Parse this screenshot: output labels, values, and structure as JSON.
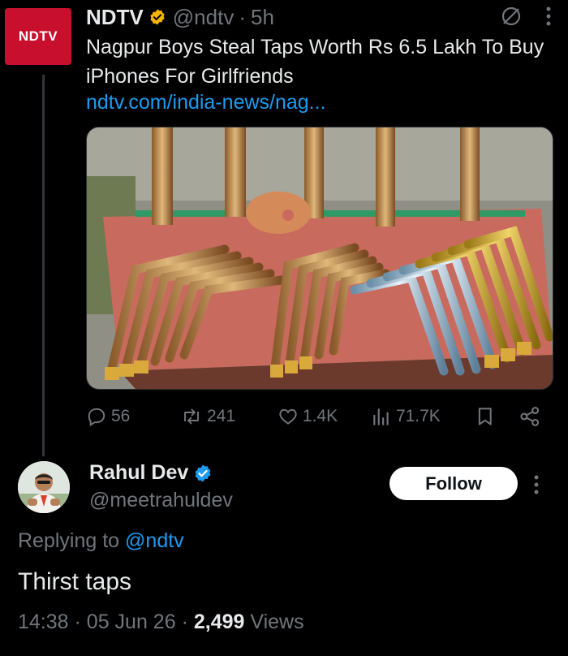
{
  "tweet": {
    "logo_text": "NDTV",
    "author_name": "NDTV",
    "author_handle": "@ndtv",
    "time": "5h",
    "text": "Nagpur Boys Steal Taps Worth Rs 6.5 Lakh To Buy iPhones For Girlfriends",
    "link": "ndtv.com/india-news/nag...",
    "media_icon": "photo-of-stolen-taps",
    "stats": {
      "replies": "56",
      "reposts": "241",
      "likes": "1.4K",
      "views": "71.7K"
    }
  },
  "reply": {
    "author_name": "Rahul Dev",
    "author_handle": "@meetrahuldev",
    "follow_label": "Follow",
    "replying_prefix": "Replying to",
    "replying_handle": "@ndtv",
    "text": "Thirst taps",
    "time": "14:38",
    "date": "05 Jun 26",
    "views_count": "2,499",
    "views_label": "Views"
  },
  "colors": {
    "background": "#000000",
    "accent": "#1d9bf0",
    "muted": "#71767b",
    "brand": "#c8102e",
    "verified": "#f4b400"
  }
}
